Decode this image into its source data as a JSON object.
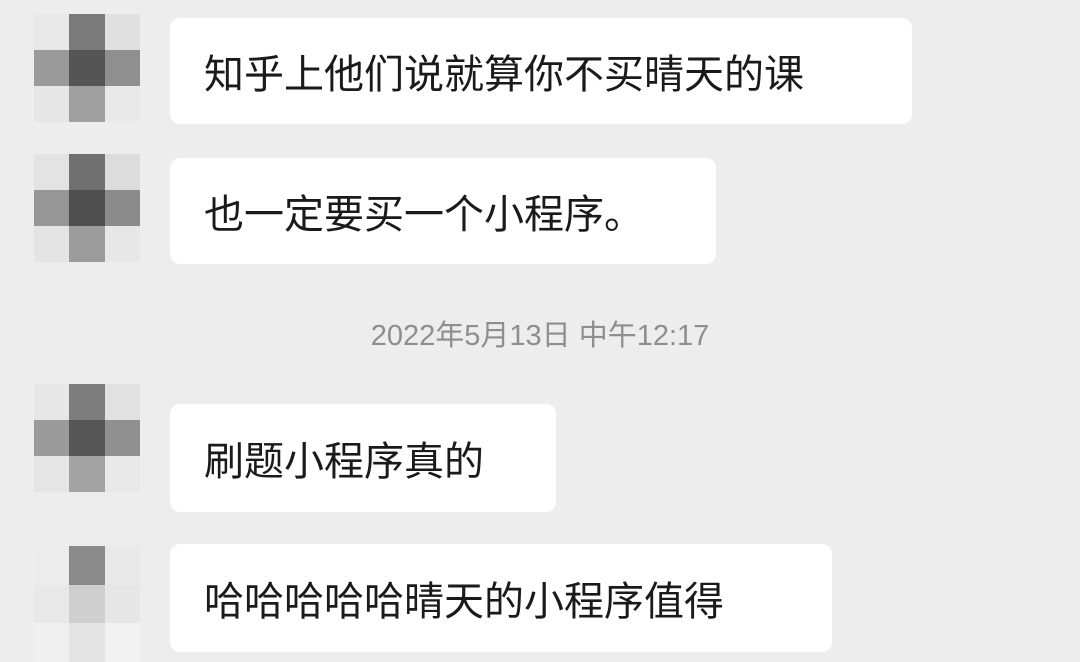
{
  "messages": [
    {
      "text": "知乎上他们说就算你不买晴天的课"
    },
    {
      "text": "也一定要买一个小程序。"
    },
    {
      "text": "刷题小程序真的"
    },
    {
      "text": "哈哈哈哈哈晴天的小程序值得"
    }
  ],
  "timestamp": "2022年5月13日 中午12:17",
  "colors": {
    "background": "#ededed",
    "bubble": "#ffffff",
    "text": "#1a1a1a",
    "timestamp": "#8e8e8e"
  }
}
